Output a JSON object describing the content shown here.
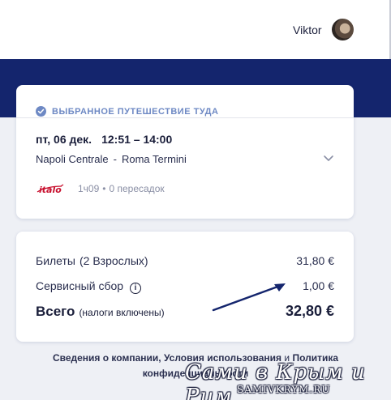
{
  "header": {
    "user_name": "Viktor"
  },
  "trip": {
    "heading": "ВЫБРАННОЕ ПУТЕШЕСТВИЕ ТУДА",
    "date": "пт, 06 дек.",
    "time": "12:51 – 14:00",
    "origin": "Napoli Centrale",
    "separator": "-",
    "destination": "Roma Termini",
    "operator_logo": "italo-logo",
    "duration": "1ч09",
    "bullet": "•",
    "transfers": "0 пересадок"
  },
  "price": {
    "tickets_label": "Билеты",
    "tickets_qualifier": "(2 Взрослых)",
    "tickets_value": "31,80 €",
    "service_label": "Сервисный сбор",
    "service_value": "1,00 €",
    "total_label": "Всего",
    "total_note": "(налоги включены)",
    "total_value": "32,80 €"
  },
  "footer": {
    "company_info": "Сведения о компании",
    "sep1": ",",
    "terms": "Условия использования",
    "and": "и",
    "privacy": "Политика конфиденциальности"
  },
  "watermark": {
    "text": "Сами в Крым и Рим",
    "url": "SAMIVKRYM.RU"
  },
  "colors": {
    "brand_navy": "#14256d",
    "accent_blue": "#6e89c4",
    "italo_red": "#c8102e",
    "annotation_arrow": "#14256d"
  }
}
